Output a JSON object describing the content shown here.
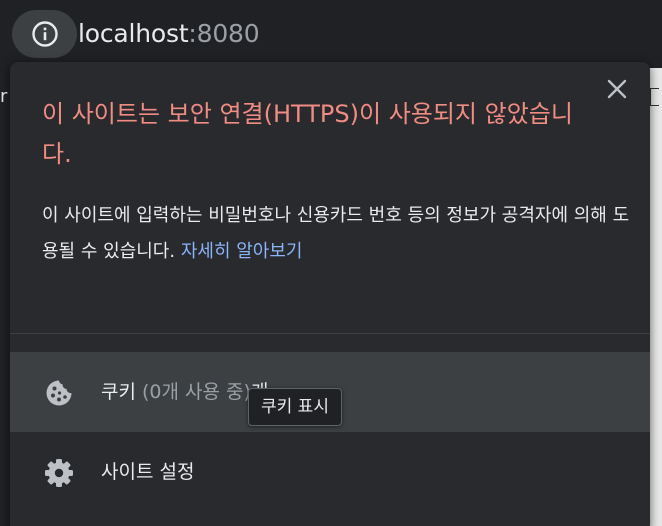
{
  "omnibox": {
    "host": "localhost",
    "port": ":8080",
    "icon": "info-icon"
  },
  "bubble": {
    "title": "이 사이트는 보안 연결(HTTPS)이 사용되지 않았습니다.",
    "description": "이 사이트에 입력하는 비밀번호나 신용카드 번호 등의 정보가 공격자에 의해 도용될 수 있습니다.",
    "learn_more": "자세히 알아보기",
    "close_icon": "close-icon",
    "cookies": {
      "label": "쿠키",
      "detail": "(0개 사용 중)",
      "suffix": "개",
      "icon": "cookie-icon"
    },
    "site_settings": {
      "label": "사이트 설정",
      "icon": "gear-icon"
    },
    "tooltip": "쿠키 표시"
  },
  "colors": {
    "warning": "#f28b82",
    "link": "#8ab4f8",
    "bubble_bg": "#292a2d",
    "hover_row": "#3c4043"
  }
}
